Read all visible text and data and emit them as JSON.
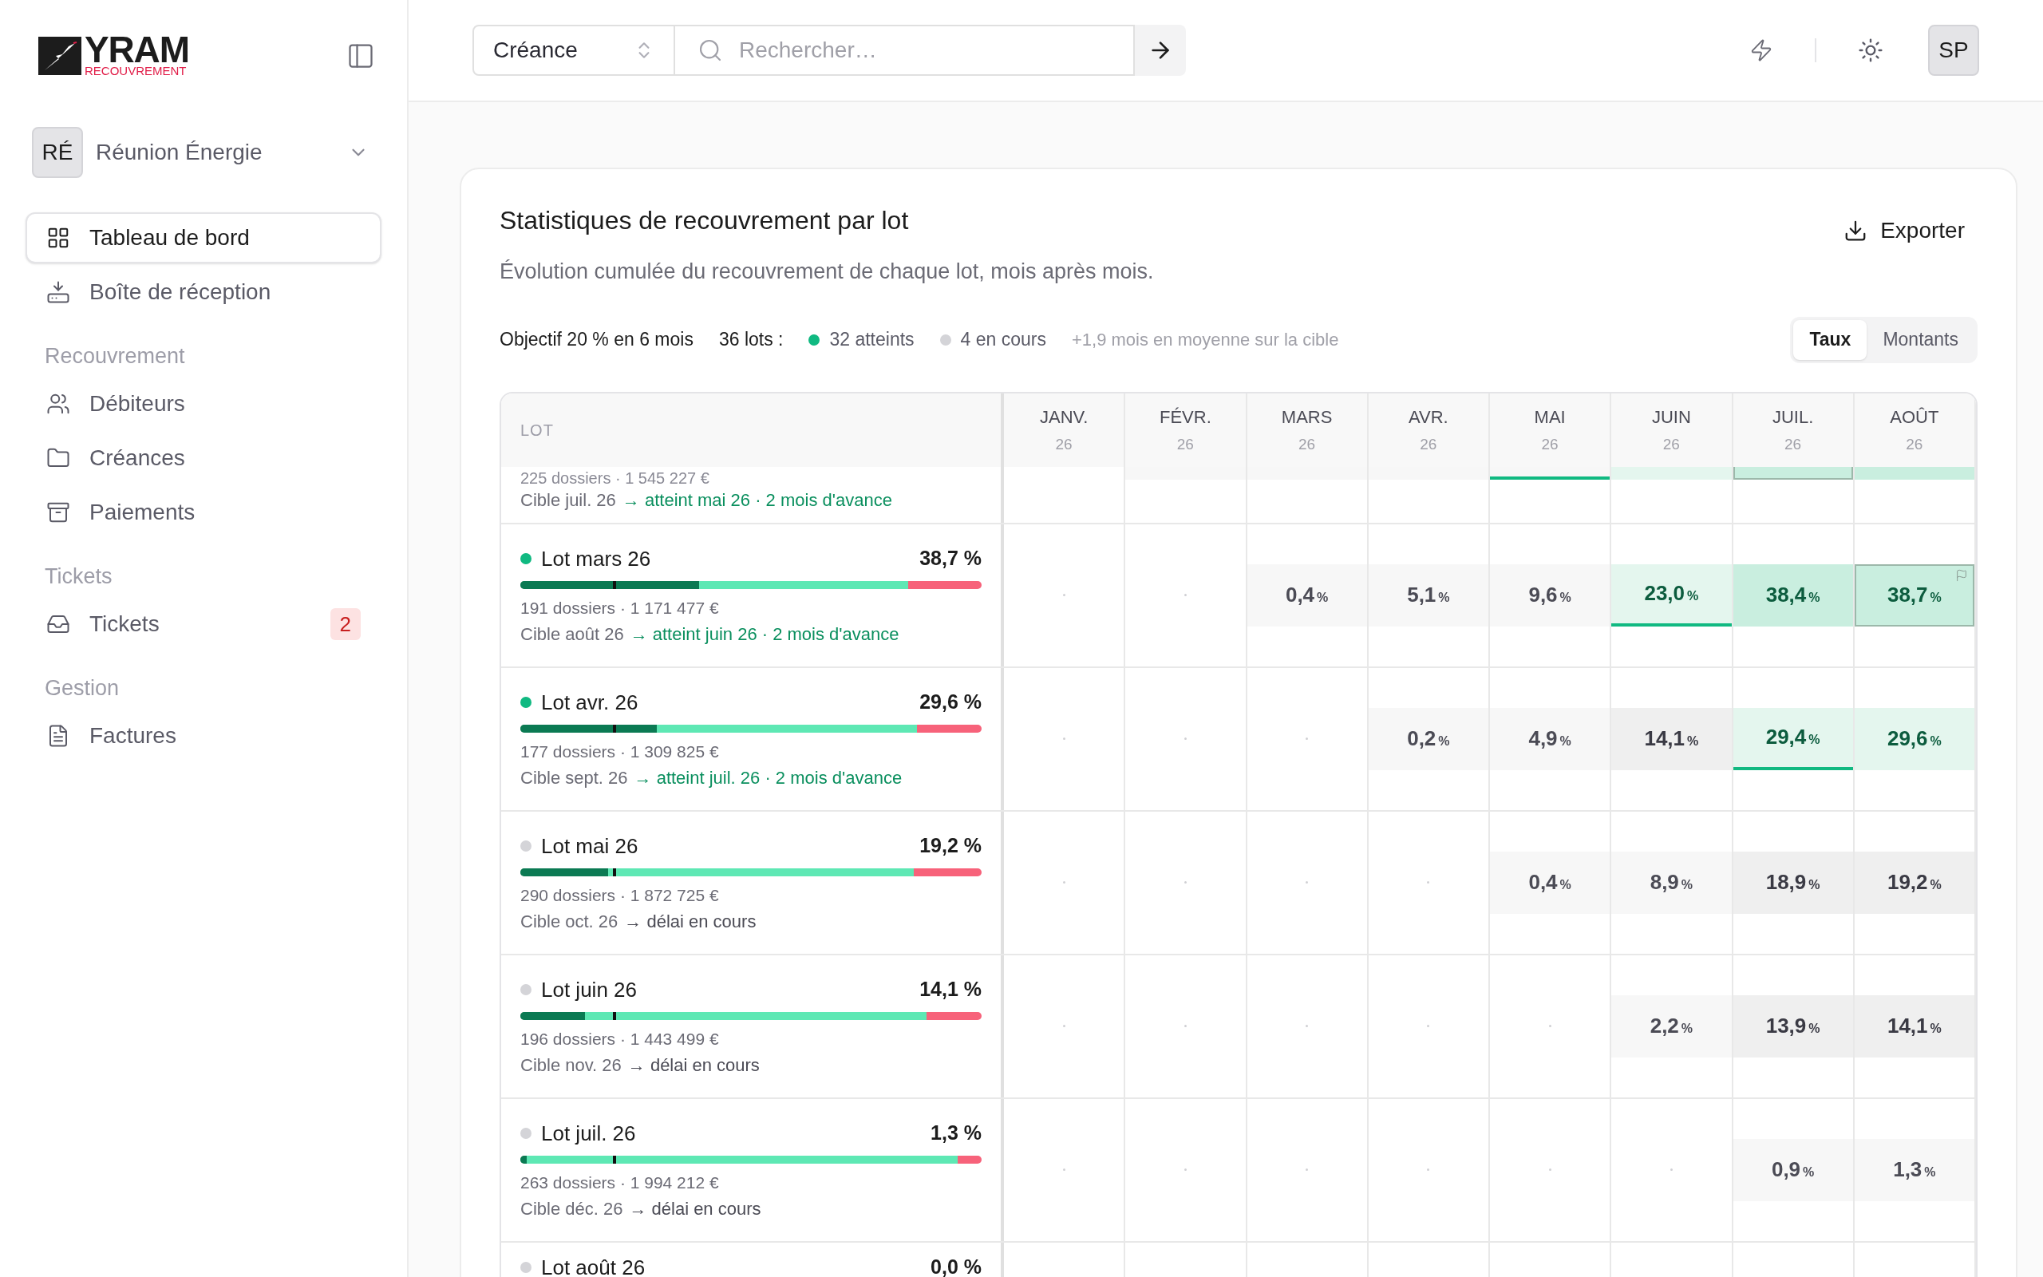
{
  "sidebar": {
    "logo": {
      "name": "YRAM",
      "tagline": "RECOUVREMENT"
    },
    "org": {
      "initials": "RÉ",
      "name": "Réunion Énergie"
    },
    "sections": [
      {
        "items": [
          {
            "label": "Tableau de bord",
            "selected": true
          },
          {
            "label": "Boîte de réception",
            "selected": false
          }
        ]
      },
      {
        "title": "Recouvrement",
        "items": [
          {
            "label": "Débiteurs",
            "selected": false
          },
          {
            "label": "Créances",
            "selected": false
          },
          {
            "label": "Paiements",
            "selected": false
          }
        ]
      },
      {
        "title": "Tickets",
        "items": [
          {
            "label": "Tickets",
            "selected": false,
            "badge": "2"
          }
        ]
      },
      {
        "title": "Gestion",
        "items": [
          {
            "label": "Factures",
            "selected": false
          }
        ]
      }
    ]
  },
  "header": {
    "scope": "Créance",
    "search": {
      "placeholder": "Rechercher…"
    },
    "user_initials": "SP"
  },
  "card": {
    "title": "Statistiques de recouvrement par lot",
    "subtitle": "Évolution cumulée du recouvrement de chaque lot, mois après mois.",
    "export_label": "Exporter",
    "summary": {
      "objective": "Objectif 20 % en 6 mois",
      "lots": "36 lots :",
      "reached": "32 atteints",
      "in_progress": "4 en cours",
      "average": "+1,9 mois en moyenne sur la cible"
    },
    "view_tabs": [
      {
        "label": "Taux",
        "selected": true
      },
      {
        "label": "Montants",
        "selected": false
      }
    ],
    "table": {
      "lot_header": "LOT",
      "months": [
        {
          "name": "JANV.",
          "year": "26"
        },
        {
          "name": "FÉVR.",
          "year": "26"
        },
        {
          "name": "MARS",
          "year": "26"
        },
        {
          "name": "AVR.",
          "year": "26"
        },
        {
          "name": "MAI",
          "year": "26"
        },
        {
          "name": "JUIN",
          "year": "26"
        },
        {
          "name": "JUIL.",
          "year": "26"
        },
        {
          "name": "AOÛT",
          "year": "26"
        }
      ],
      "rows": [
        {
          "kind": "partial",
          "reached": true,
          "details": "225 dossiers · 1 545 227 €",
          "target": "Cible juil. 26",
          "outcome": "→ atteint mai 26 · 2 mois d'avance",
          "cells": [
            {
              "kind": "empty"
            },
            {
              "kind": "low"
            },
            {
              "kind": "low"
            },
            {
              "kind": "low"
            },
            {
              "kind": "low",
              "first_reached": true
            },
            {
              "kind": "hit"
            },
            {
              "kind": "high",
              "target": true
            },
            {
              "kind": "high"
            }
          ]
        },
        {
          "kind": "full",
          "reached": true,
          "name": "Lot mars 26",
          "rate": "38,7 %",
          "bar": {
            "level": 0.387,
            "projection": {
              "level": 0.84
            },
            "target": {
              "level": 0.2
            }
          },
          "details": "191 dossiers · 1 171 477 €",
          "target": "Cible août 26",
          "outcome": "→ atteint juin 26 · 2 mois d'avance",
          "cells": [
            {
              "kind": "empty"
            },
            {
              "kind": "empty"
            },
            {
              "kind": "low",
              "value": "0,4",
              "unit": "%"
            },
            {
              "kind": "low",
              "value": "5,1",
              "unit": "%"
            },
            {
              "kind": "low",
              "value": "9,6",
              "unit": "%"
            },
            {
              "kind": "hit",
              "value": "23,0",
              "unit": "%",
              "first_reached": true
            },
            {
              "kind": "high",
              "value": "38,4",
              "unit": "%"
            },
            {
              "kind": "high",
              "value": "38,7",
              "unit": "%",
              "target": true
            }
          ]
        },
        {
          "kind": "full",
          "reached": true,
          "name": "Lot avr. 26",
          "rate": "29,6 %",
          "bar": {
            "level": 0.295,
            "projection": {
              "level": 0.859
            },
            "target": {
              "level": 0.2
            }
          },
          "details": "177 dossiers · 1 309 825 €",
          "target": "Cible sept. 26",
          "outcome": "→ atteint juil. 26 · 2 mois d'avance",
          "cells": [
            {
              "kind": "empty"
            },
            {
              "kind": "empty"
            },
            {
              "kind": "empty"
            },
            {
              "kind": "low",
              "value": "0,2",
              "unit": "%"
            },
            {
              "kind": "low",
              "value": "4,9",
              "unit": "%"
            },
            {
              "kind": "mid",
              "value": "14,1",
              "unit": "%"
            },
            {
              "kind": "hit",
              "value": "29,4",
              "unit": "%",
              "first_reached": true
            },
            {
              "kind": "hit",
              "value": "29,6",
              "unit": "%"
            }
          ]
        },
        {
          "kind": "full",
          "reached": false,
          "name": "Lot mai 26",
          "rate": "19,2 %",
          "bar": {
            "level": 0.19,
            "projection": {
              "level": 0.853
            },
            "target": {
              "level": 0.2
            }
          },
          "details": "290 dossiers · 1 872 725 €",
          "target": "Cible oct. 26",
          "outcome": "→ délai en cours",
          "cells": [
            {
              "kind": "empty"
            },
            {
              "kind": "empty"
            },
            {
              "kind": "empty"
            },
            {
              "kind": "empty"
            },
            {
              "kind": "low",
              "value": "0,4",
              "unit": "%"
            },
            {
              "kind": "low",
              "value": "8,9",
              "unit": "%"
            },
            {
              "kind": "mid",
              "value": "18,9",
              "unit": "%"
            },
            {
              "kind": "mid",
              "value": "19,2",
              "unit": "%"
            }
          ]
        },
        {
          "kind": "full",
          "reached": false,
          "name": "Lot juin 26",
          "rate": "14,1 %",
          "bar": {
            "level": 0.14,
            "projection": {
              "level": 0.88
            },
            "target": {
              "level": 0.2
            }
          },
          "details": "196 dossiers · 1 443 499 €",
          "target": "Cible nov. 26",
          "outcome": "→ délai en cours",
          "cells": [
            {
              "kind": "empty"
            },
            {
              "kind": "empty"
            },
            {
              "kind": "empty"
            },
            {
              "kind": "empty"
            },
            {
              "kind": "empty"
            },
            {
              "kind": "low",
              "value": "2,2",
              "unit": "%"
            },
            {
              "kind": "mid",
              "value": "13,9",
              "unit": "%"
            },
            {
              "kind": "mid",
              "value": "14,1",
              "unit": "%"
            }
          ]
        },
        {
          "kind": "full",
          "reached": false,
          "name": "Lot juil. 26",
          "rate": "1,3 %",
          "bar": {
            "level": 0.013,
            "projection": {
              "level": 0.948
            },
            "target": {
              "level": 0.2
            }
          },
          "details": "263 dossiers · 1 994 212 €",
          "target": "Cible déc. 26",
          "outcome": "→ délai en cours",
          "cells": [
            {
              "kind": "empty"
            },
            {
              "kind": "empty"
            },
            {
              "kind": "empty"
            },
            {
              "kind": "empty"
            },
            {
              "kind": "empty"
            },
            {
              "kind": "empty"
            },
            {
              "kind": "low",
              "value": "0,9",
              "unit": "%"
            },
            {
              "kind": "low",
              "value": "1,3",
              "unit": "%"
            }
          ]
        },
        {
          "kind": "cut",
          "reached": false,
          "name": "Lot août 26",
          "rate": "0,0 %"
        }
      ]
    }
  }
}
